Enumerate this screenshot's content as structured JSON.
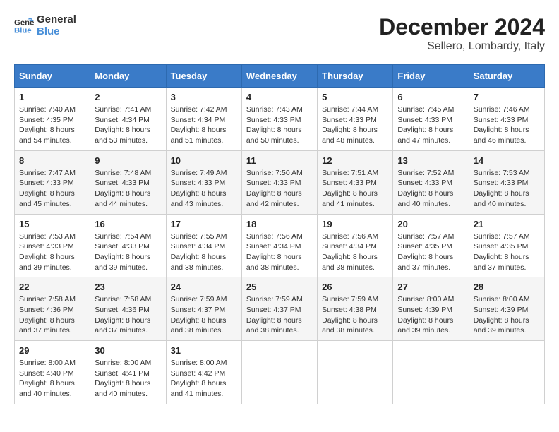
{
  "header": {
    "logo_line1": "General",
    "logo_line2": "Blue",
    "month": "December 2024",
    "location": "Sellero, Lombardy, Italy"
  },
  "days_of_week": [
    "Sunday",
    "Monday",
    "Tuesday",
    "Wednesday",
    "Thursday",
    "Friday",
    "Saturday"
  ],
  "weeks": [
    [
      {
        "day": "1",
        "sunrise": "Sunrise: 7:40 AM",
        "sunset": "Sunset: 4:35 PM",
        "daylight": "Daylight: 8 hours and 54 minutes."
      },
      {
        "day": "2",
        "sunrise": "Sunrise: 7:41 AM",
        "sunset": "Sunset: 4:34 PM",
        "daylight": "Daylight: 8 hours and 53 minutes."
      },
      {
        "day": "3",
        "sunrise": "Sunrise: 7:42 AM",
        "sunset": "Sunset: 4:34 PM",
        "daylight": "Daylight: 8 hours and 51 minutes."
      },
      {
        "day": "4",
        "sunrise": "Sunrise: 7:43 AM",
        "sunset": "Sunset: 4:33 PM",
        "daylight": "Daylight: 8 hours and 50 minutes."
      },
      {
        "day": "5",
        "sunrise": "Sunrise: 7:44 AM",
        "sunset": "Sunset: 4:33 PM",
        "daylight": "Daylight: 8 hours and 48 minutes."
      },
      {
        "day": "6",
        "sunrise": "Sunrise: 7:45 AM",
        "sunset": "Sunset: 4:33 PM",
        "daylight": "Daylight: 8 hours and 47 minutes."
      },
      {
        "day": "7",
        "sunrise": "Sunrise: 7:46 AM",
        "sunset": "Sunset: 4:33 PM",
        "daylight": "Daylight: 8 hours and 46 minutes."
      }
    ],
    [
      {
        "day": "8",
        "sunrise": "Sunrise: 7:47 AM",
        "sunset": "Sunset: 4:33 PM",
        "daylight": "Daylight: 8 hours and 45 minutes."
      },
      {
        "day": "9",
        "sunrise": "Sunrise: 7:48 AM",
        "sunset": "Sunset: 4:33 PM",
        "daylight": "Daylight: 8 hours and 44 minutes."
      },
      {
        "day": "10",
        "sunrise": "Sunrise: 7:49 AM",
        "sunset": "Sunset: 4:33 PM",
        "daylight": "Daylight: 8 hours and 43 minutes."
      },
      {
        "day": "11",
        "sunrise": "Sunrise: 7:50 AM",
        "sunset": "Sunset: 4:33 PM",
        "daylight": "Daylight: 8 hours and 42 minutes."
      },
      {
        "day": "12",
        "sunrise": "Sunrise: 7:51 AM",
        "sunset": "Sunset: 4:33 PM",
        "daylight": "Daylight: 8 hours and 41 minutes."
      },
      {
        "day": "13",
        "sunrise": "Sunrise: 7:52 AM",
        "sunset": "Sunset: 4:33 PM",
        "daylight": "Daylight: 8 hours and 40 minutes."
      },
      {
        "day": "14",
        "sunrise": "Sunrise: 7:53 AM",
        "sunset": "Sunset: 4:33 PM",
        "daylight": "Daylight: 8 hours and 40 minutes."
      }
    ],
    [
      {
        "day": "15",
        "sunrise": "Sunrise: 7:53 AM",
        "sunset": "Sunset: 4:33 PM",
        "daylight": "Daylight: 8 hours and 39 minutes."
      },
      {
        "day": "16",
        "sunrise": "Sunrise: 7:54 AM",
        "sunset": "Sunset: 4:33 PM",
        "daylight": "Daylight: 8 hours and 39 minutes."
      },
      {
        "day": "17",
        "sunrise": "Sunrise: 7:55 AM",
        "sunset": "Sunset: 4:34 PM",
        "daylight": "Daylight: 8 hours and 38 minutes."
      },
      {
        "day": "18",
        "sunrise": "Sunrise: 7:56 AM",
        "sunset": "Sunset: 4:34 PM",
        "daylight": "Daylight: 8 hours and 38 minutes."
      },
      {
        "day": "19",
        "sunrise": "Sunrise: 7:56 AM",
        "sunset": "Sunset: 4:34 PM",
        "daylight": "Daylight: 8 hours and 38 minutes."
      },
      {
        "day": "20",
        "sunrise": "Sunrise: 7:57 AM",
        "sunset": "Sunset: 4:35 PM",
        "daylight": "Daylight: 8 hours and 37 minutes."
      },
      {
        "day": "21",
        "sunrise": "Sunrise: 7:57 AM",
        "sunset": "Sunset: 4:35 PM",
        "daylight": "Daylight: 8 hours and 37 minutes."
      }
    ],
    [
      {
        "day": "22",
        "sunrise": "Sunrise: 7:58 AM",
        "sunset": "Sunset: 4:36 PM",
        "daylight": "Daylight: 8 hours and 37 minutes."
      },
      {
        "day": "23",
        "sunrise": "Sunrise: 7:58 AM",
        "sunset": "Sunset: 4:36 PM",
        "daylight": "Daylight: 8 hours and 37 minutes."
      },
      {
        "day": "24",
        "sunrise": "Sunrise: 7:59 AM",
        "sunset": "Sunset: 4:37 PM",
        "daylight": "Daylight: 8 hours and 38 minutes."
      },
      {
        "day": "25",
        "sunrise": "Sunrise: 7:59 AM",
        "sunset": "Sunset: 4:37 PM",
        "daylight": "Daylight: 8 hours and 38 minutes."
      },
      {
        "day": "26",
        "sunrise": "Sunrise: 7:59 AM",
        "sunset": "Sunset: 4:38 PM",
        "daylight": "Daylight: 8 hours and 38 minutes."
      },
      {
        "day": "27",
        "sunrise": "Sunrise: 8:00 AM",
        "sunset": "Sunset: 4:39 PM",
        "daylight": "Daylight: 8 hours and 39 minutes."
      },
      {
        "day": "28",
        "sunrise": "Sunrise: 8:00 AM",
        "sunset": "Sunset: 4:39 PM",
        "daylight": "Daylight: 8 hours and 39 minutes."
      }
    ],
    [
      {
        "day": "29",
        "sunrise": "Sunrise: 8:00 AM",
        "sunset": "Sunset: 4:40 PM",
        "daylight": "Daylight: 8 hours and 40 minutes."
      },
      {
        "day": "30",
        "sunrise": "Sunrise: 8:00 AM",
        "sunset": "Sunset: 4:41 PM",
        "daylight": "Daylight: 8 hours and 40 minutes."
      },
      {
        "day": "31",
        "sunrise": "Sunrise: 8:00 AM",
        "sunset": "Sunset: 4:42 PM",
        "daylight": "Daylight: 8 hours and 41 minutes."
      },
      null,
      null,
      null,
      null
    ]
  ]
}
